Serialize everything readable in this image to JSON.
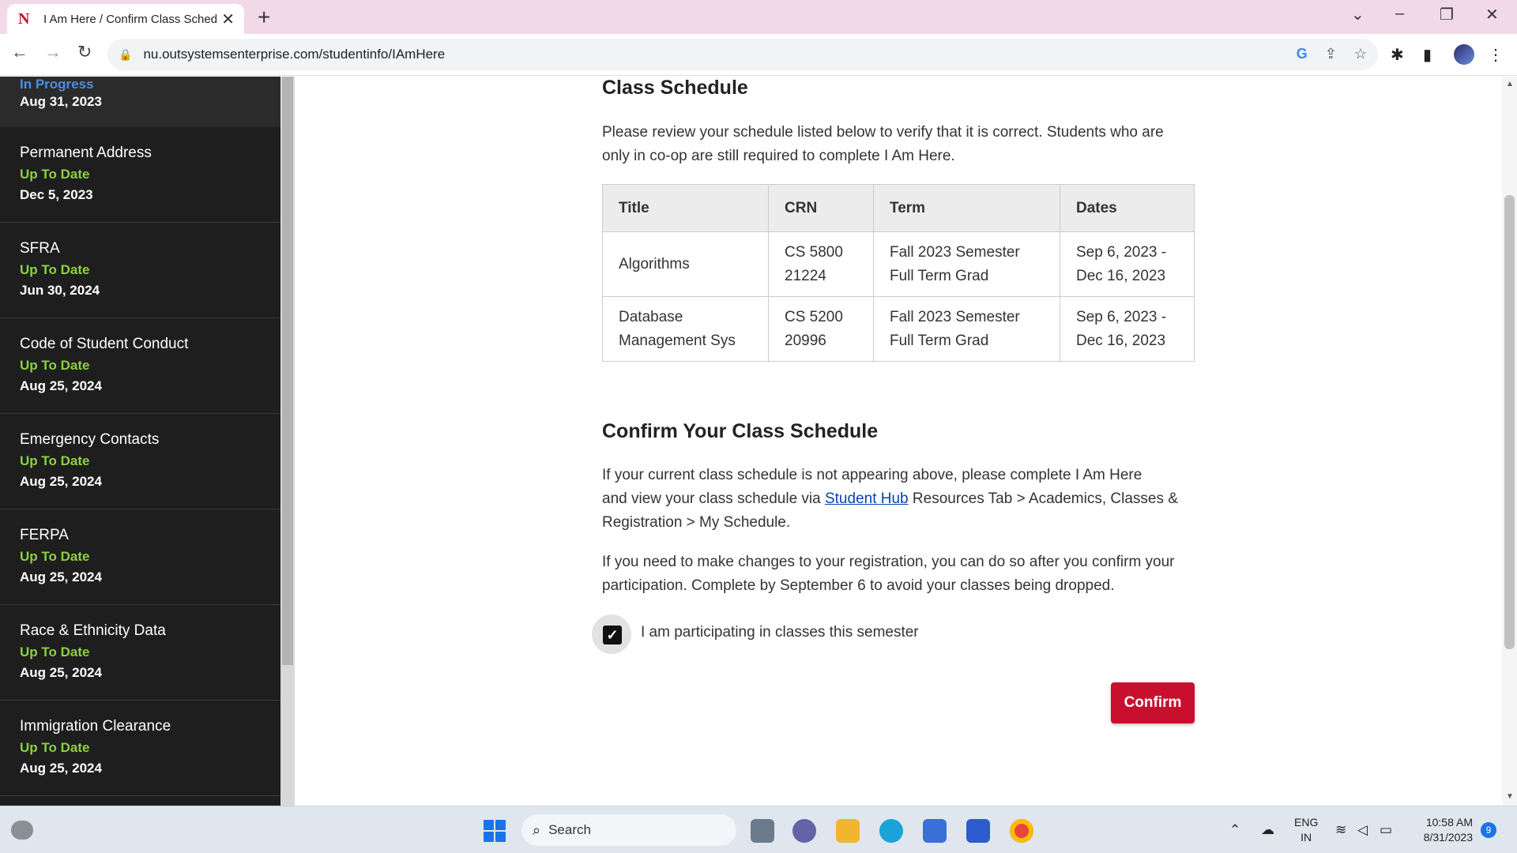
{
  "browser": {
    "tab_title": "I Am Here / Confirm Class Schedule",
    "tab_favicon": "N",
    "url": "nu.outsystemsenterprise.com/studentinfo/IAmHere"
  },
  "sidebar": {
    "top": {
      "status": "In Progress",
      "date": "Aug 31, 2023"
    },
    "items": [
      {
        "name": "Permanent Address",
        "status": "Up To Date",
        "date": "Dec 5, 2023"
      },
      {
        "name": "SFRA",
        "status": "Up To Date",
        "date": "Jun 30, 2024"
      },
      {
        "name": "Code of Student Conduct",
        "status": "Up To Date",
        "date": "Aug 25, 2024"
      },
      {
        "name": "Emergency Contacts",
        "status": "Up To Date",
        "date": "Aug 25, 2024"
      },
      {
        "name": "FERPA",
        "status": "Up To Date",
        "date": "Aug 25, 2024"
      },
      {
        "name": "Race & Ethnicity Data",
        "status": "Up To Date",
        "date": "Aug 25, 2024"
      },
      {
        "name": "Immigration Clearance",
        "status": "Up To Date",
        "date": "Aug 25, 2024"
      }
    ]
  },
  "main": {
    "schedule_heading": "Class Schedule",
    "schedule_intro_1": "Please review your schedule listed below to verify that it is correct. Students who are",
    "schedule_intro_2": "only in co-op are still required to complete I Am Here.",
    "table": {
      "headers": [
        "Title",
        "CRN",
        "Term",
        "Dates"
      ],
      "rows": [
        {
          "title": "Algorithms",
          "title_2": "",
          "crn_1": "CS 5800",
          "crn_2": "21224",
          "term_1": "Fall 2023 Semester",
          "term_2": "Full Term Grad",
          "dates_1": "Sep 6, 2023 -",
          "dates_2": "Dec 16, 2023"
        },
        {
          "title": "Database",
          "title_2": "Management Sys",
          "crn_1": "CS 5200",
          "crn_2": "20996",
          "term_1": "Fall 2023 Semester",
          "term_2": "Full Term Grad",
          "dates_1": "Sep 6, 2023 -",
          "dates_2": "Dec 16, 2023"
        }
      ]
    },
    "confirm_heading": "Confirm Your Class Schedule",
    "confirm_p1_line1": "If your current class schedule is not appearing above, please complete I Am Here",
    "confirm_p1_line2_pre": "and view your class schedule via ",
    "confirm_p1_link": "Student Hub",
    "confirm_p1_line2_post": " Resources Tab > Academics, Classes &",
    "confirm_p1_line3": "Registration > My Schedule.",
    "confirm_p2_line1": "If you need to make changes to your registration, you can do so after you confirm your",
    "confirm_p2_line2": "participation. Complete by September 6 to avoid your classes being dropped.",
    "checkbox_label": "I am participating in classes this semester",
    "checkbox_checked": true,
    "confirm_button": "Confirm"
  },
  "taskbar": {
    "search_label": "Search",
    "lang_1": "ENG",
    "lang_2": "IN",
    "time": "10:58 AM",
    "date": "8/31/2023",
    "notifications": "9"
  },
  "colors": {
    "accent_red": "#c8102e",
    "status_green": "#8cd13d",
    "status_blue": "#4a90e2",
    "sidebar_bg": "#1e1e1e"
  }
}
